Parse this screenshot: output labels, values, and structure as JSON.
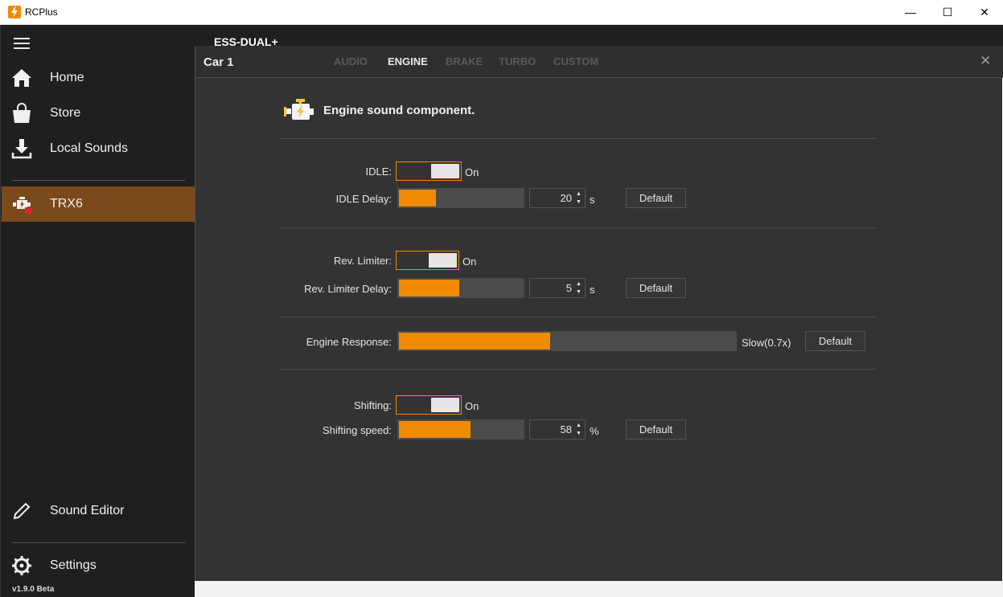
{
  "window": {
    "title": "RCPlus",
    "minimize": "—",
    "maximize": "☐",
    "close": "✕"
  },
  "sidebar": {
    "items": [
      {
        "label": "Home",
        "icon": "home-icon"
      },
      {
        "label": "Store",
        "icon": "store-bag-icon"
      },
      {
        "label": "Local Sounds",
        "icon": "download-icon"
      },
      {
        "label": "TRX6",
        "icon": "engine-icon"
      },
      {
        "label": "Sound Editor",
        "icon": "pencil-icon"
      },
      {
        "label": "Settings",
        "icon": "gear-icon"
      }
    ],
    "active_item": "TRX6",
    "version": "v1.9.0 Beta"
  },
  "background_title": "ESS-DUAL+",
  "panel": {
    "title": "Car 1",
    "tabs": [
      "AUDIO",
      "ENGINE",
      "BRAKE",
      "TURBO",
      "CUSTOM"
    ],
    "active_tab": "ENGINE",
    "close": "✕",
    "section_title": "Engine sound component.",
    "idle": {
      "label": "IDLE:",
      "state": "On"
    },
    "idle_delay": {
      "label": "IDLE Delay:",
      "value": "20",
      "unit": "s",
      "default_label": "Default",
      "fill_fraction": 0.3
    },
    "rev_limiter": {
      "label": "Rev. Limiter:",
      "state": "On"
    },
    "rev_limiter_delay": {
      "label": "Rev. Limiter Delay:",
      "value": "5",
      "unit": "s",
      "default_label": "Default",
      "fill_fraction": 0.49
    },
    "engine_response": {
      "label": "Engine Response:",
      "value_text": "Slow(0.7x)",
      "default_label": "Default",
      "fill_fraction": 0.45
    },
    "shifting": {
      "label": "Shifting:",
      "state": "On"
    },
    "shifting_speed": {
      "label": "Shifting speed:",
      "value": "58",
      "unit": "%",
      "default_label": "Default",
      "fill_fraction": 0.58
    }
  },
  "colors": {
    "accent": "#f08a00",
    "sidebar_bg": "#1f1f1f",
    "panel_bg": "#333333",
    "active_nav": "#7a4a1a"
  }
}
